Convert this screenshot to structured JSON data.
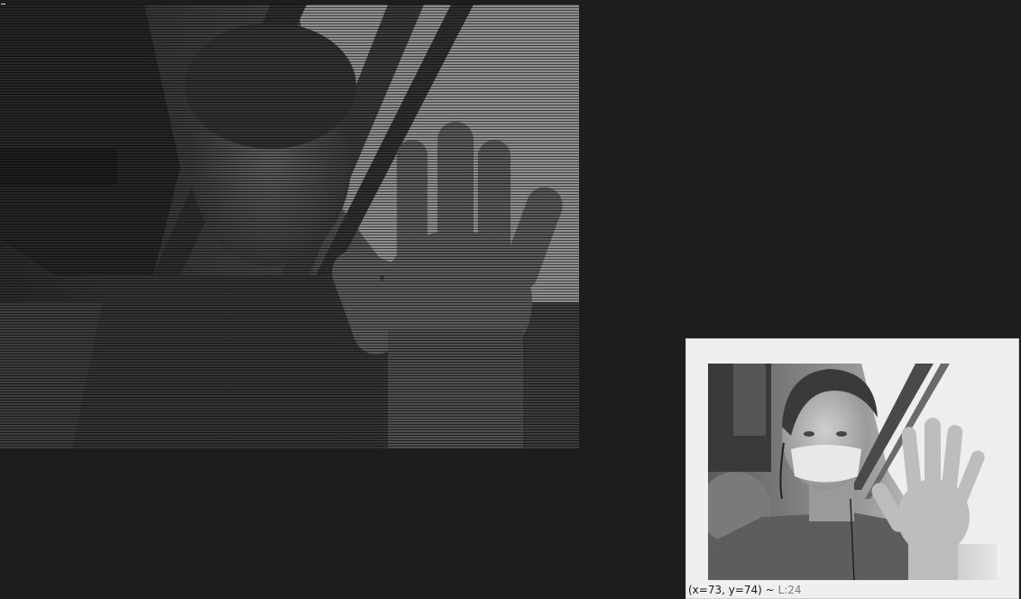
{
  "terminal": {
    "cursor_glyph": "▯",
    "render_description_hidden": ""
  },
  "preview": {
    "status": {
      "coords": "(x=73, y=74) ~ ",
      "level": "L:24"
    }
  },
  "colors": {
    "terminal_bg": "#1d1d1d",
    "window_bg": "#efefef",
    "status_text": "#1a1a1a",
    "status_level": "#7a7a7a"
  }
}
